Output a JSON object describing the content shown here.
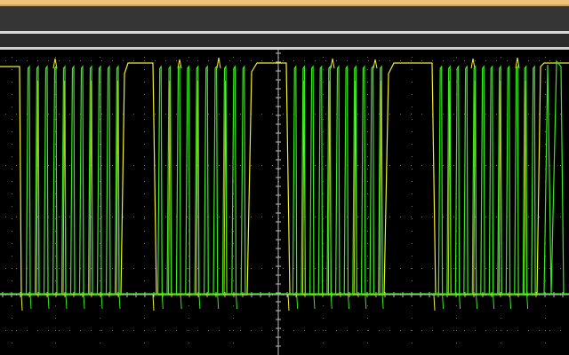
{
  "screen": {
    "background": "#000000",
    "toolbar_color": "#353535",
    "accent_color": "#f1c27a"
  },
  "scope_display": {
    "trace_colors": {
      "ch1": "#f2ef2a",
      "ch2": "#38e81c"
    }
  }
}
